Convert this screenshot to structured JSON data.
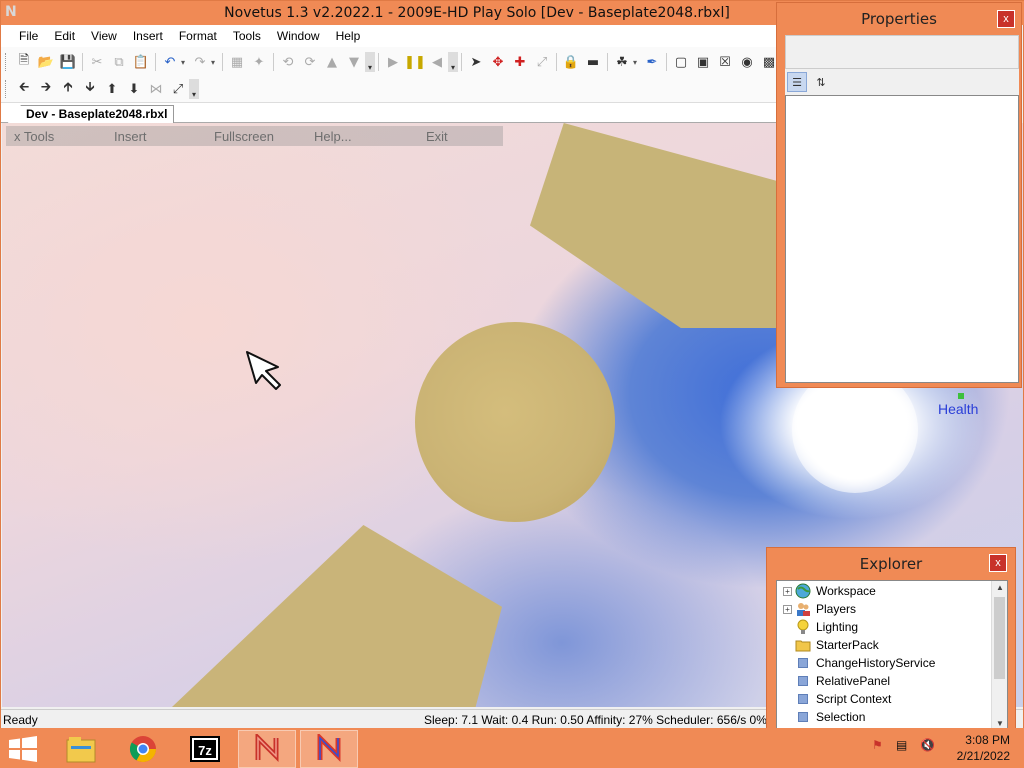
{
  "window": {
    "title": "Novetus 1.3 v2.2022.1 - 2009E-HD Play Solo [Dev - Baseplate2048.rbxl]",
    "app_icon_glyph": "N"
  },
  "menu": [
    "File",
    "Edit",
    "View",
    "Insert",
    "Format",
    "Tools",
    "Window",
    "Help"
  ],
  "document_tab": "Dev - Baseplate2048.rbxl",
  "ingame_toolbar": {
    "tools": "x Tools",
    "insert": "Insert",
    "fullscreen": "Fullscreen",
    "help": "Help...",
    "exit": "Exit"
  },
  "hud": {
    "health_label": "Health",
    "health_color": "#2a3ed8"
  },
  "status_bar": {
    "ready": "Ready",
    "stats": "Sleep: 7.1 Wait: 0.4 Run: 0.50 Affinity: 27% Scheduler: 656/s 0%"
  },
  "properties_panel": {
    "title": "Properties",
    "close": "x",
    "categorized_icon": "categorized-icon",
    "sort_icon": "sort-alphabetical-icon"
  },
  "explorer_panel": {
    "title": "Explorer",
    "close": "x",
    "items": [
      {
        "label": "Workspace",
        "icon": "globe-icon",
        "expandable": true
      },
      {
        "label": "Players",
        "icon": "players-icon",
        "expandable": true
      },
      {
        "label": "Lighting",
        "icon": "lightbulb-icon",
        "expandable": false
      },
      {
        "label": "StarterPack",
        "icon": "folder-icon",
        "expandable": false
      },
      {
        "label": "ChangeHistoryService",
        "icon": "service-icon",
        "expandable": false
      },
      {
        "label": "RelativePanel",
        "icon": "service-icon",
        "expandable": false
      },
      {
        "label": "Script Context",
        "icon": "service-icon",
        "expandable": false
      },
      {
        "label": "Selection",
        "icon": "service-icon",
        "expandable": false
      }
    ]
  },
  "taskbar": {
    "apps": [
      "file-explorer",
      "chrome",
      "7zip",
      "novetus",
      "novetus-client"
    ],
    "sevenzip_label": "7z",
    "clock_time": "3:08 PM",
    "clock_date": "2/21/2022"
  },
  "colors": {
    "accent": "#f08a55",
    "close_button": "#c8322a",
    "part_color": "#c9b479"
  }
}
